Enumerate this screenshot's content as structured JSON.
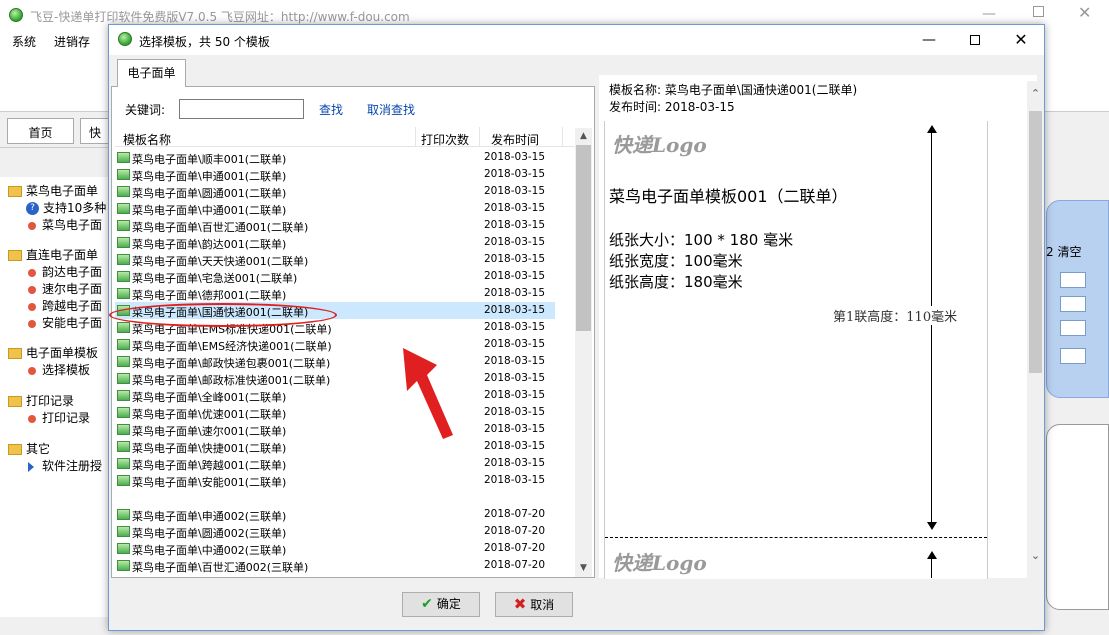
{
  "bg_window": {
    "title": "飞豆-快递单打印软件免费版V7.0.5   飞豆网址：http://www.f-dou.com",
    "menu": [
      "系统",
      "进销存",
      " "
    ],
    "tabs": [
      "首页",
      "快"
    ],
    "tree": {
      "g1": "菜鸟电子面单",
      "g1_item1": "支持10多种",
      "g1_item2": "菜鸟电子面",
      "g2": "直连电子面单",
      "g2_item1": "韵达电子面",
      "g2_item2": "速尔电子面",
      "g2_item3": "跨越电子面",
      "g2_item4": "安能电子面",
      "g3": "电子面单模板",
      "g3_item1": "选择模板",
      "g4": "打印记录",
      "g4_item1": "打印记录",
      "g5": "其它",
      "g5_item1": "软件注册授"
    },
    "right_clear": "2 清空"
  },
  "dialog": {
    "title": "选择模板，共 50 个模板",
    "tab": "电子面单",
    "keyword_label": "关键词:",
    "keyword_value": "",
    "search_btn": "查找",
    "cancel_search_btn": "取消查找",
    "columns": {
      "name": "模板名称",
      "count": "打印次数",
      "date": "发布时间"
    },
    "rows": [
      {
        "name": "菜鸟电子面单\\顺丰001(二联单)",
        "date": "2018-03-15"
      },
      {
        "name": "菜鸟电子面单\\申通001(二联单)",
        "date": "2018-03-15"
      },
      {
        "name": "菜鸟电子面单\\圆通001(二联单)",
        "date": "2018-03-15"
      },
      {
        "name": "菜鸟电子面单\\中通001(二联单)",
        "date": "2018-03-15"
      },
      {
        "name": "菜鸟电子面单\\百世汇通001(二联单)",
        "date": "2018-03-15"
      },
      {
        "name": "菜鸟电子面单\\韵达001(二联单)",
        "date": "2018-03-15"
      },
      {
        "name": "菜鸟电子面单\\天天快递001(二联单)",
        "date": "2018-03-15"
      },
      {
        "name": "菜鸟电子面单\\宅急送001(二联单)",
        "date": "2018-03-15"
      },
      {
        "name": "菜鸟电子面单\\德邦001(二联单)",
        "date": "2018-03-15"
      },
      {
        "name": "菜鸟电子面单\\国通快递001(二联单)",
        "date": "2018-03-15",
        "selected": true
      },
      {
        "name": "菜鸟电子面单\\EMS标准快递001(二联单)",
        "date": "2018-03-15"
      },
      {
        "name": "菜鸟电子面单\\EMS经济快递001(二联单)",
        "date": "2018-03-15"
      },
      {
        "name": "菜鸟电子面单\\邮政快递包裹001(二联单)",
        "date": "2018-03-15"
      },
      {
        "name": "菜鸟电子面单\\邮政标准快递001(二联单)",
        "date": "2018-03-15"
      },
      {
        "name": "菜鸟电子面单\\全峰001(二联单)",
        "date": "2018-03-15"
      },
      {
        "name": "菜鸟电子面单\\优速001(二联单)",
        "date": "2018-03-15"
      },
      {
        "name": "菜鸟电子面单\\速尔001(二联单)",
        "date": "2018-03-15"
      },
      {
        "name": "菜鸟电子面单\\快捷001(二联单)",
        "date": "2018-03-15"
      },
      {
        "name": "菜鸟电子面单\\跨越001(二联单)",
        "date": "2018-03-15"
      },
      {
        "name": "菜鸟电子面单\\安能001(二联单)",
        "date": "2018-03-15"
      },
      {
        "name": "菜鸟电子面单\\申通002(三联单)",
        "date": "2018-07-20",
        "gap": true
      },
      {
        "name": "菜鸟电子面单\\圆通002(三联单)",
        "date": "2018-07-20"
      },
      {
        "name": "菜鸟电子面单\\中通002(三联单)",
        "date": "2018-07-20"
      },
      {
        "name": "菜鸟电子面单\\百世汇通002(三联单)",
        "date": "2018-07-20"
      }
    ],
    "preview": {
      "name_line": "模板名称: 菜鸟电子面单\\国通快递001(二联单)",
      "date_line": "发布时间: 2018-03-15",
      "logo": "快递Logo",
      "template_title": "菜鸟电子面单模板001（二联单）",
      "paper_size": "纸张大小：100 * 180 毫米",
      "paper_width": "纸张宽度：100毫米",
      "paper_height": "纸张高度：180毫米",
      "first_height": "第1联高度：110毫米"
    },
    "ok_btn": "确定",
    "cancel_btn": "取消"
  }
}
